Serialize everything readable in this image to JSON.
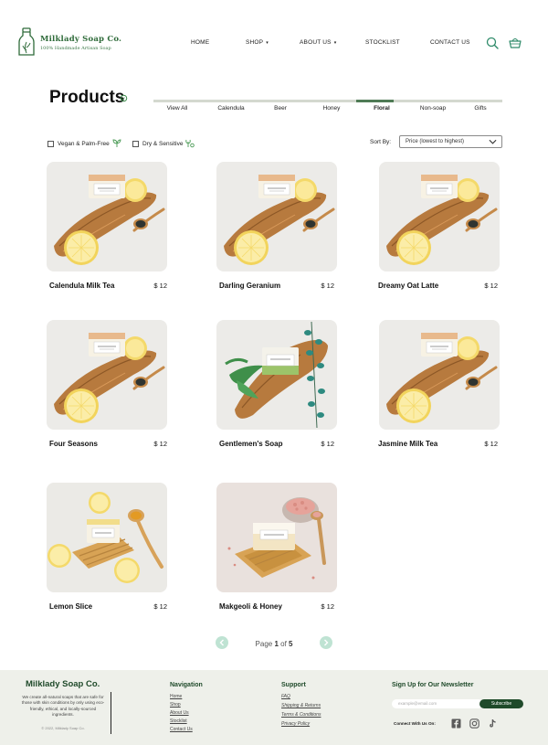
{
  "brand": {
    "name": "Milklady Soap Co.",
    "tagline": "100% Handmade Artisan Soap",
    "green": "#2f6b3a"
  },
  "nav": {
    "items": [
      "HOME",
      "SHOP",
      "ABOUT US",
      "STOCKLIST",
      "CONTACT US"
    ],
    "icons": [
      "search-icon",
      "basket-icon"
    ]
  },
  "page": {
    "title": "Products"
  },
  "tabs": {
    "labels": [
      "View All",
      "Calendula",
      "Beer",
      "Honey",
      "Floral",
      "Non-soap",
      "Gifts"
    ],
    "active": "Floral"
  },
  "filters": {
    "vegan": "Vegan & Palm-Free",
    "dry": "Dry & Sensitive"
  },
  "sort": {
    "label": "Sort By:",
    "value": "Price (lowest to highest)"
  },
  "products": [
    {
      "name": "Calendula Milk Tea",
      "price": "$ 12",
      "image": "lemon-soap-board"
    },
    {
      "name": "Darling Geranium",
      "price": "$ 12",
      "image": "lemon-soap-board"
    },
    {
      "name": "Dreamy Oat Latte",
      "price": "$ 12",
      "image": "lemon-soap-board"
    },
    {
      "name": "Four Seasons",
      "price": "$ 12",
      "image": "lemon-soap-board"
    },
    {
      "name": "Gentlemen's Soap",
      "price": "$ 12",
      "image": "eucalyptus-soap-board"
    },
    {
      "name": "Jasmine Milk Tea",
      "price": "$ 12",
      "image": "lemon-soap-board"
    },
    {
      "name": "Lemon Slice",
      "price": "$ 12",
      "image": "lemon-soap-dish"
    },
    {
      "name": "Makgeoli & Honey",
      "price": "$ 12",
      "image": "salt-soap-dish"
    }
  ],
  "pagination": {
    "page": "1",
    "total": "5"
  },
  "footer": {
    "brand": "Milklady Soap Co.",
    "description": "We create all-natural soaps that are safe for those with skin conditions by only using eco-friendly, ethical, and locally-sourced ingredients.",
    "copyright": "© 2022, Milklady Soap Co.",
    "navigation": {
      "heading": "Navigation",
      "links": [
        "Home",
        "Shop",
        "About Us",
        "Stocklist",
        "Contact Us"
      ]
    },
    "support": {
      "heading": "Support",
      "links": [
        "FAQ",
        "Shipping & Returns",
        "Terms & Conditions",
        "Privacy Policy"
      ]
    },
    "newsletter": {
      "heading": "Sign Up for Our Newsletter",
      "placeholder": "example@email.com",
      "button": "Subscribe",
      "connect": "Connect With Us On:",
      "socials": [
        "facebook-icon",
        "instagram-icon",
        "tiktok-icon"
      ]
    }
  }
}
